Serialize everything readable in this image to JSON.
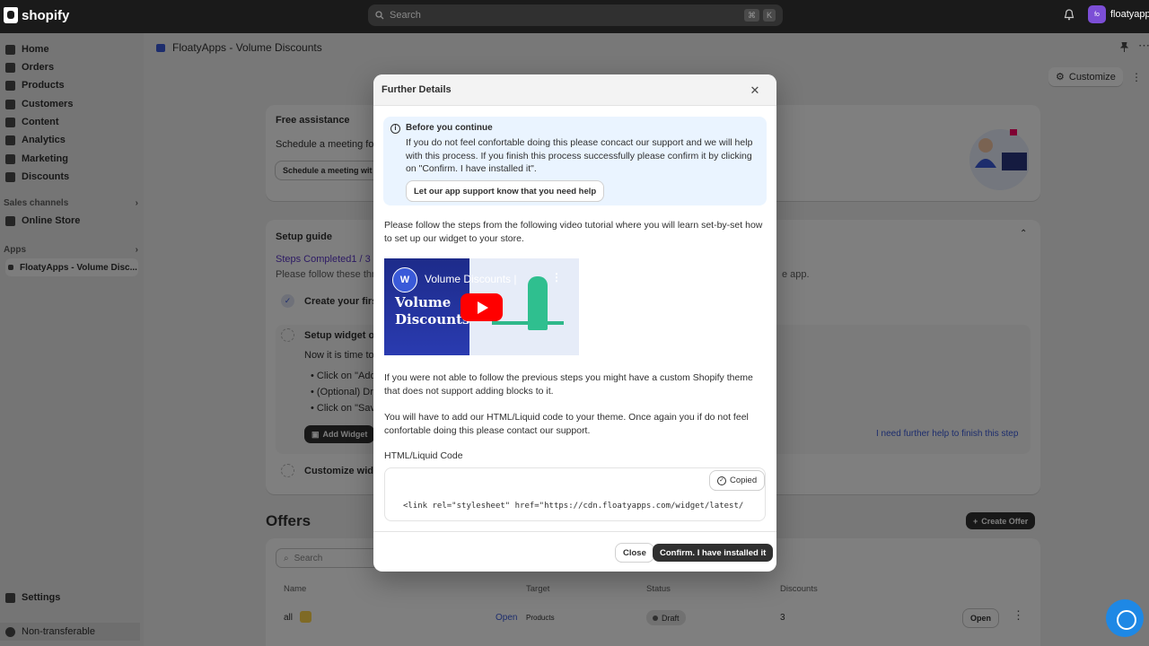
{
  "topbar": {
    "brand": "shopify",
    "search_placeholder": "Search",
    "kbd": [
      "⌘",
      "K"
    ],
    "store_initials": "fo",
    "store_name": "floatyapps"
  },
  "sidebar": {
    "items": [
      {
        "label": "Home",
        "icon": "home-icon"
      },
      {
        "label": "Orders",
        "icon": "orders-icon"
      },
      {
        "label": "Products",
        "icon": "tag-icon"
      },
      {
        "label": "Customers",
        "icon": "person-icon"
      },
      {
        "label": "Content",
        "icon": "content-icon"
      },
      {
        "label": "Analytics",
        "icon": "chart-icon"
      },
      {
        "label": "Marketing",
        "icon": "target-icon"
      },
      {
        "label": "Discounts",
        "icon": "discount-icon"
      }
    ],
    "sales_channels": "Sales channels",
    "online_store": "Online Store",
    "apps": "Apps",
    "app_item": "FloatyApps - Volume Disc...",
    "settings": "Settings",
    "non_transferable": "Non-transferable"
  },
  "page": {
    "title": "FloatyApps - Volume Discounts",
    "customize": "Customize",
    "free_assistance": {
      "title": "Free assistance",
      "text": "Schedule a meeting fo",
      "button": "Schedule a meeting wit"
    },
    "setup_guide": {
      "title": "Setup guide",
      "steps": "Steps Completed1 / 3",
      "text": "Please follow these thr",
      "text_tail": "e app.",
      "step1": "Create your first",
      "step2": "Setup widget on",
      "step2_text": "Now it is time to",
      "bullets": [
        "Click on \"Add",
        "(Optional) Dr",
        "Click on \"Sav"
      ],
      "add_widget": "Add Widget",
      "further_help": "I need further help to finish this step",
      "step3": "Customize widge"
    },
    "offers": {
      "title": "Offers",
      "create": "Create Offer",
      "search_placeholder": "Search",
      "columns": [
        "Name",
        "Target",
        "Status",
        "Discounts"
      ],
      "row": {
        "name": "all",
        "open_link": "Open",
        "target": "Products",
        "status": "Draft",
        "discounts": "3",
        "open_button": "Open"
      }
    }
  },
  "modal": {
    "title": "Further Details",
    "banner": {
      "title": "Before you continue",
      "text": "If you do not feel confortable doing this please concact our support and we will help with this process. If you finish this process successfully please confirm it by clicking on \"Confirm. I have installed it\".",
      "button": "Let our app support know that you need help"
    },
    "para1": "Please follow the steps from the following video tutorial where you will learn set-by-set how to set up our widget to your store.",
    "video": {
      "title": "Volume Discounts |",
      "overlay_line1": "Volume",
      "overlay_line2": "Discounts"
    },
    "para2": "If you were not able to follow the previous steps you might have a custom Shopify theme that does not support adding blocks to it.",
    "para3": "You will have to add our HTML/Liquid code to your theme. Once again you if do not feel confortable doing this please contact our support.",
    "code_label": "HTML/Liquid Code",
    "code": "<link rel=\"stylesheet\" href=\"https://cdn.floatyapps.com/widget/latest/",
    "copied": "Copied",
    "close": "Close",
    "confirm": "Confirm. I have installed it"
  }
}
